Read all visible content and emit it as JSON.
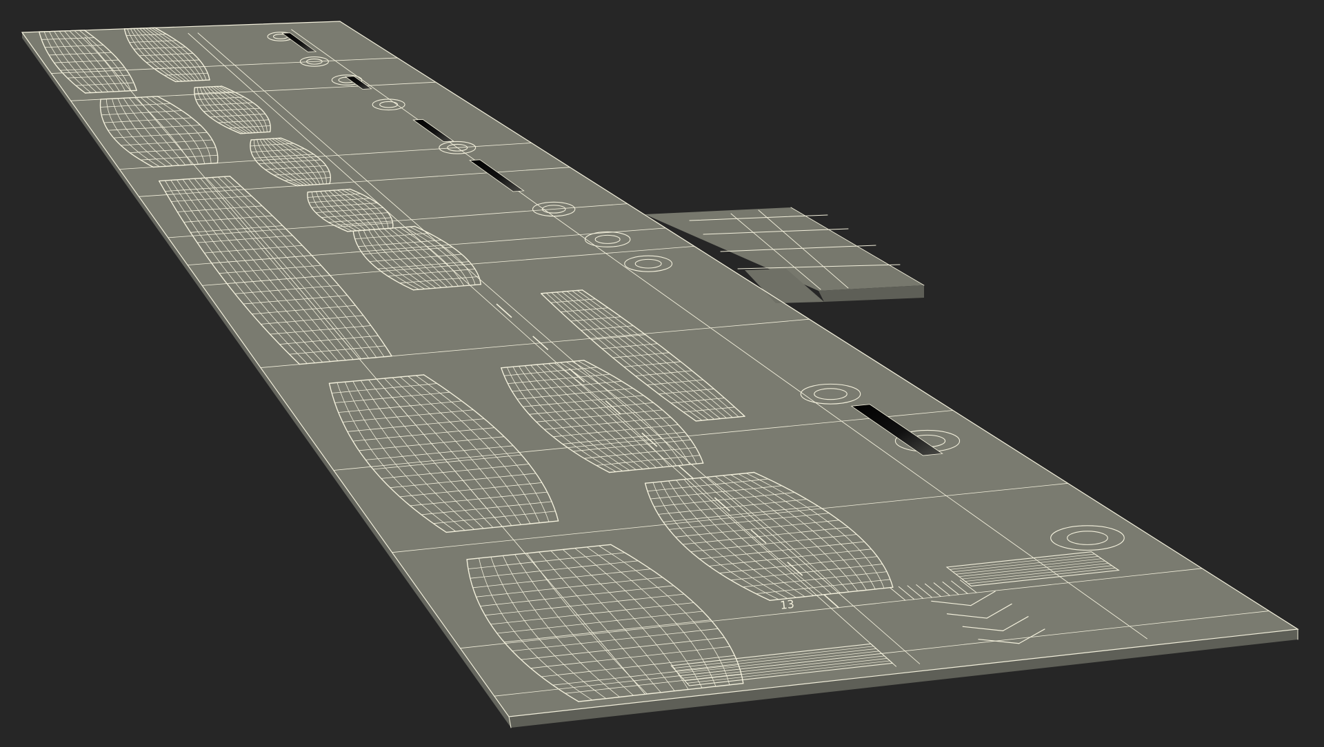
{
  "scene": {
    "background_color": "#262626",
    "surface_color": "#7a7b70",
    "surface_side_color": "#5f6058",
    "wire_color": "#f4f1dd",
    "slot_color": "#050505"
  },
  "runway_marking": {
    "number": "13"
  }
}
